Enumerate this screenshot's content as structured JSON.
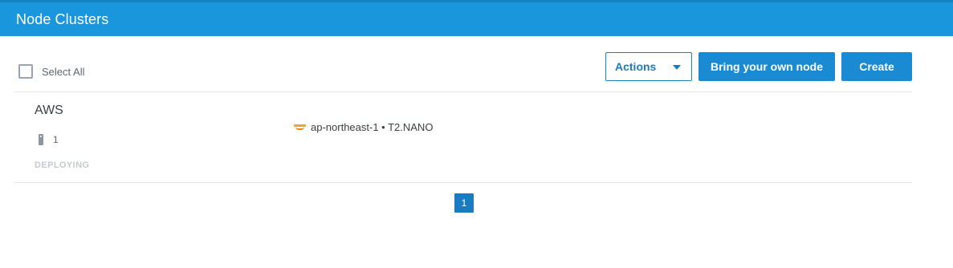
{
  "header": {
    "title": "Node Clusters"
  },
  "toolbar": {
    "select_all_label": "Select All",
    "actions_label": "Actions",
    "byon_label": "Bring your own node",
    "create_label": "Create"
  },
  "clusters": [
    {
      "name": "AWS",
      "node_count": "1",
      "status": "DEPLOYING",
      "provider_icon": "aws-icon",
      "region_type": "ap-northeast-1 • T2.NANO"
    }
  ],
  "pagination": {
    "pages": [
      "1"
    ],
    "current": "1"
  },
  "colors": {
    "header_bg": "#1a97dc",
    "primary": "#1a8ad3",
    "status_muted": "#c4cad0"
  }
}
